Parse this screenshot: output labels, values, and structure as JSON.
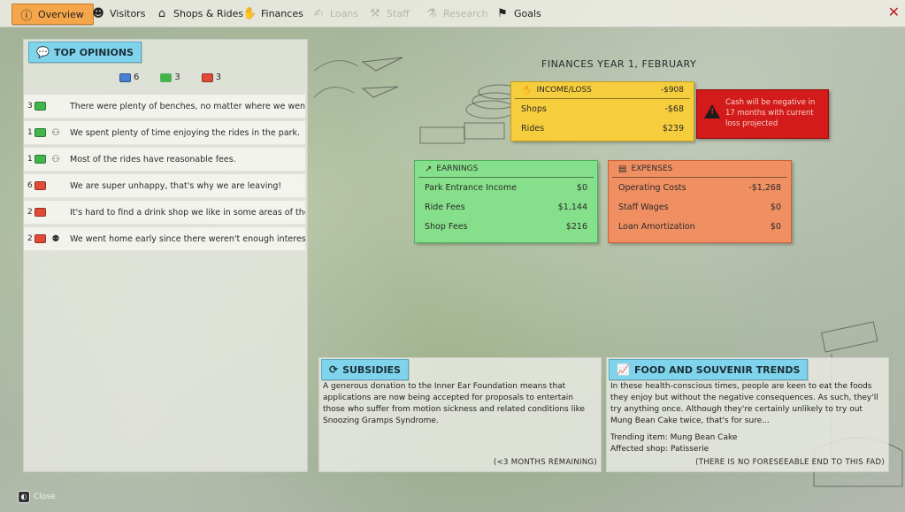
{
  "tabs": [
    {
      "label": "Overview",
      "icon": "info-circle-icon",
      "active": true
    },
    {
      "label": "Visitors",
      "icon": "visitors-icon"
    },
    {
      "label": "Shops & Rides",
      "icon": "shops-rides-icon"
    },
    {
      "label": "Finances",
      "icon": "hand-coin-icon"
    },
    {
      "label": "Loans",
      "icon": "loan-icon",
      "disabled": true
    },
    {
      "label": "Staff",
      "icon": "staff-icon",
      "disabled": true
    },
    {
      "label": "Research",
      "icon": "research-icon",
      "disabled": true
    },
    {
      "label": "Goals",
      "icon": "flag-icon"
    }
  ],
  "opinions": {
    "title": "TOP OPINIONS",
    "counts": {
      "blue": "6",
      "green": "3",
      "red": "3"
    },
    "items": [
      {
        "count": "3",
        "type": "green",
        "people": "",
        "text": "There were plenty of benches, no matter where we went."
      },
      {
        "count": "1",
        "type": "green",
        "people": "group",
        "text": "We spent plenty of time enjoying the rides in the park."
      },
      {
        "count": "1",
        "type": "green",
        "people": "group",
        "text": "Most of the rides have reasonable fees."
      },
      {
        "count": "6",
        "type": "red",
        "people": "",
        "text": "We are super unhappy,  that's why we are leaving!"
      },
      {
        "count": "2",
        "type": "red",
        "people": "",
        "text": "It's hard to find a drink shop we like in some areas of the park."
      },
      {
        "count": "2",
        "type": "red",
        "people": "family",
        "text": "We went home early since there weren't enough interesting rides."
      }
    ]
  },
  "finances": {
    "title": "FINANCES YEAR 1, FEBRUARY",
    "income_loss": {
      "label": "INCOME/LOSS",
      "value": "-$908",
      "rows": [
        {
          "label": "Shops",
          "value": "-$68"
        },
        {
          "label": "Rides",
          "value": "$239"
        }
      ]
    },
    "warning": "Cash will be negative in 17 months with current loss projected",
    "earnings": {
      "label": "EARNINGS",
      "rows": [
        {
          "label": "Park Entrance Income",
          "value": "$0"
        },
        {
          "label": "Ride Fees",
          "value": "$1,144"
        },
        {
          "label": "Shop Fees",
          "value": "$216"
        }
      ]
    },
    "expenses": {
      "label": "EXPENSES",
      "rows": [
        {
          "label": "Operating Costs",
          "value": "-$1,268"
        },
        {
          "label": "Staff Wages",
          "value": "$0"
        },
        {
          "label": "Loan Amortization",
          "value": "$0"
        }
      ]
    }
  },
  "subsidies": {
    "title": "SUBSIDIES",
    "body": "A generous donation to the Inner Ear Foundation means that applications are now being accepted for proposals to entertain those who suffer from motion sickness and related conditions like Snoozing Gramps Syndrome.",
    "footer": "(<3 MONTHS REMAINING)"
  },
  "trends": {
    "title": "FOOD AND SOUVENIR TRENDS",
    "body": "In these health-conscious times, people are keen to eat the foods they enjoy but without the negative consequences. As such, they'll try anything once. Although they're certainly unlikely to try out Mung Bean Cake twice, that's for sure...",
    "trending": "Trending item: Mung Bean Cake",
    "affected": "Affected shop: Patisserie",
    "footer": "(THERE IS NO FORESEEABLE END TO THIS FAD)"
  },
  "close_label": "Close",
  "colors": {
    "accent_orange": "#f5a64a",
    "tag_cyan": "#7fd4ec",
    "income_yellow": "#f6cd3c",
    "earnings_green": "#86e08b",
    "expenses_orange": "#f08f62",
    "warning_red": "#d31b1b"
  }
}
